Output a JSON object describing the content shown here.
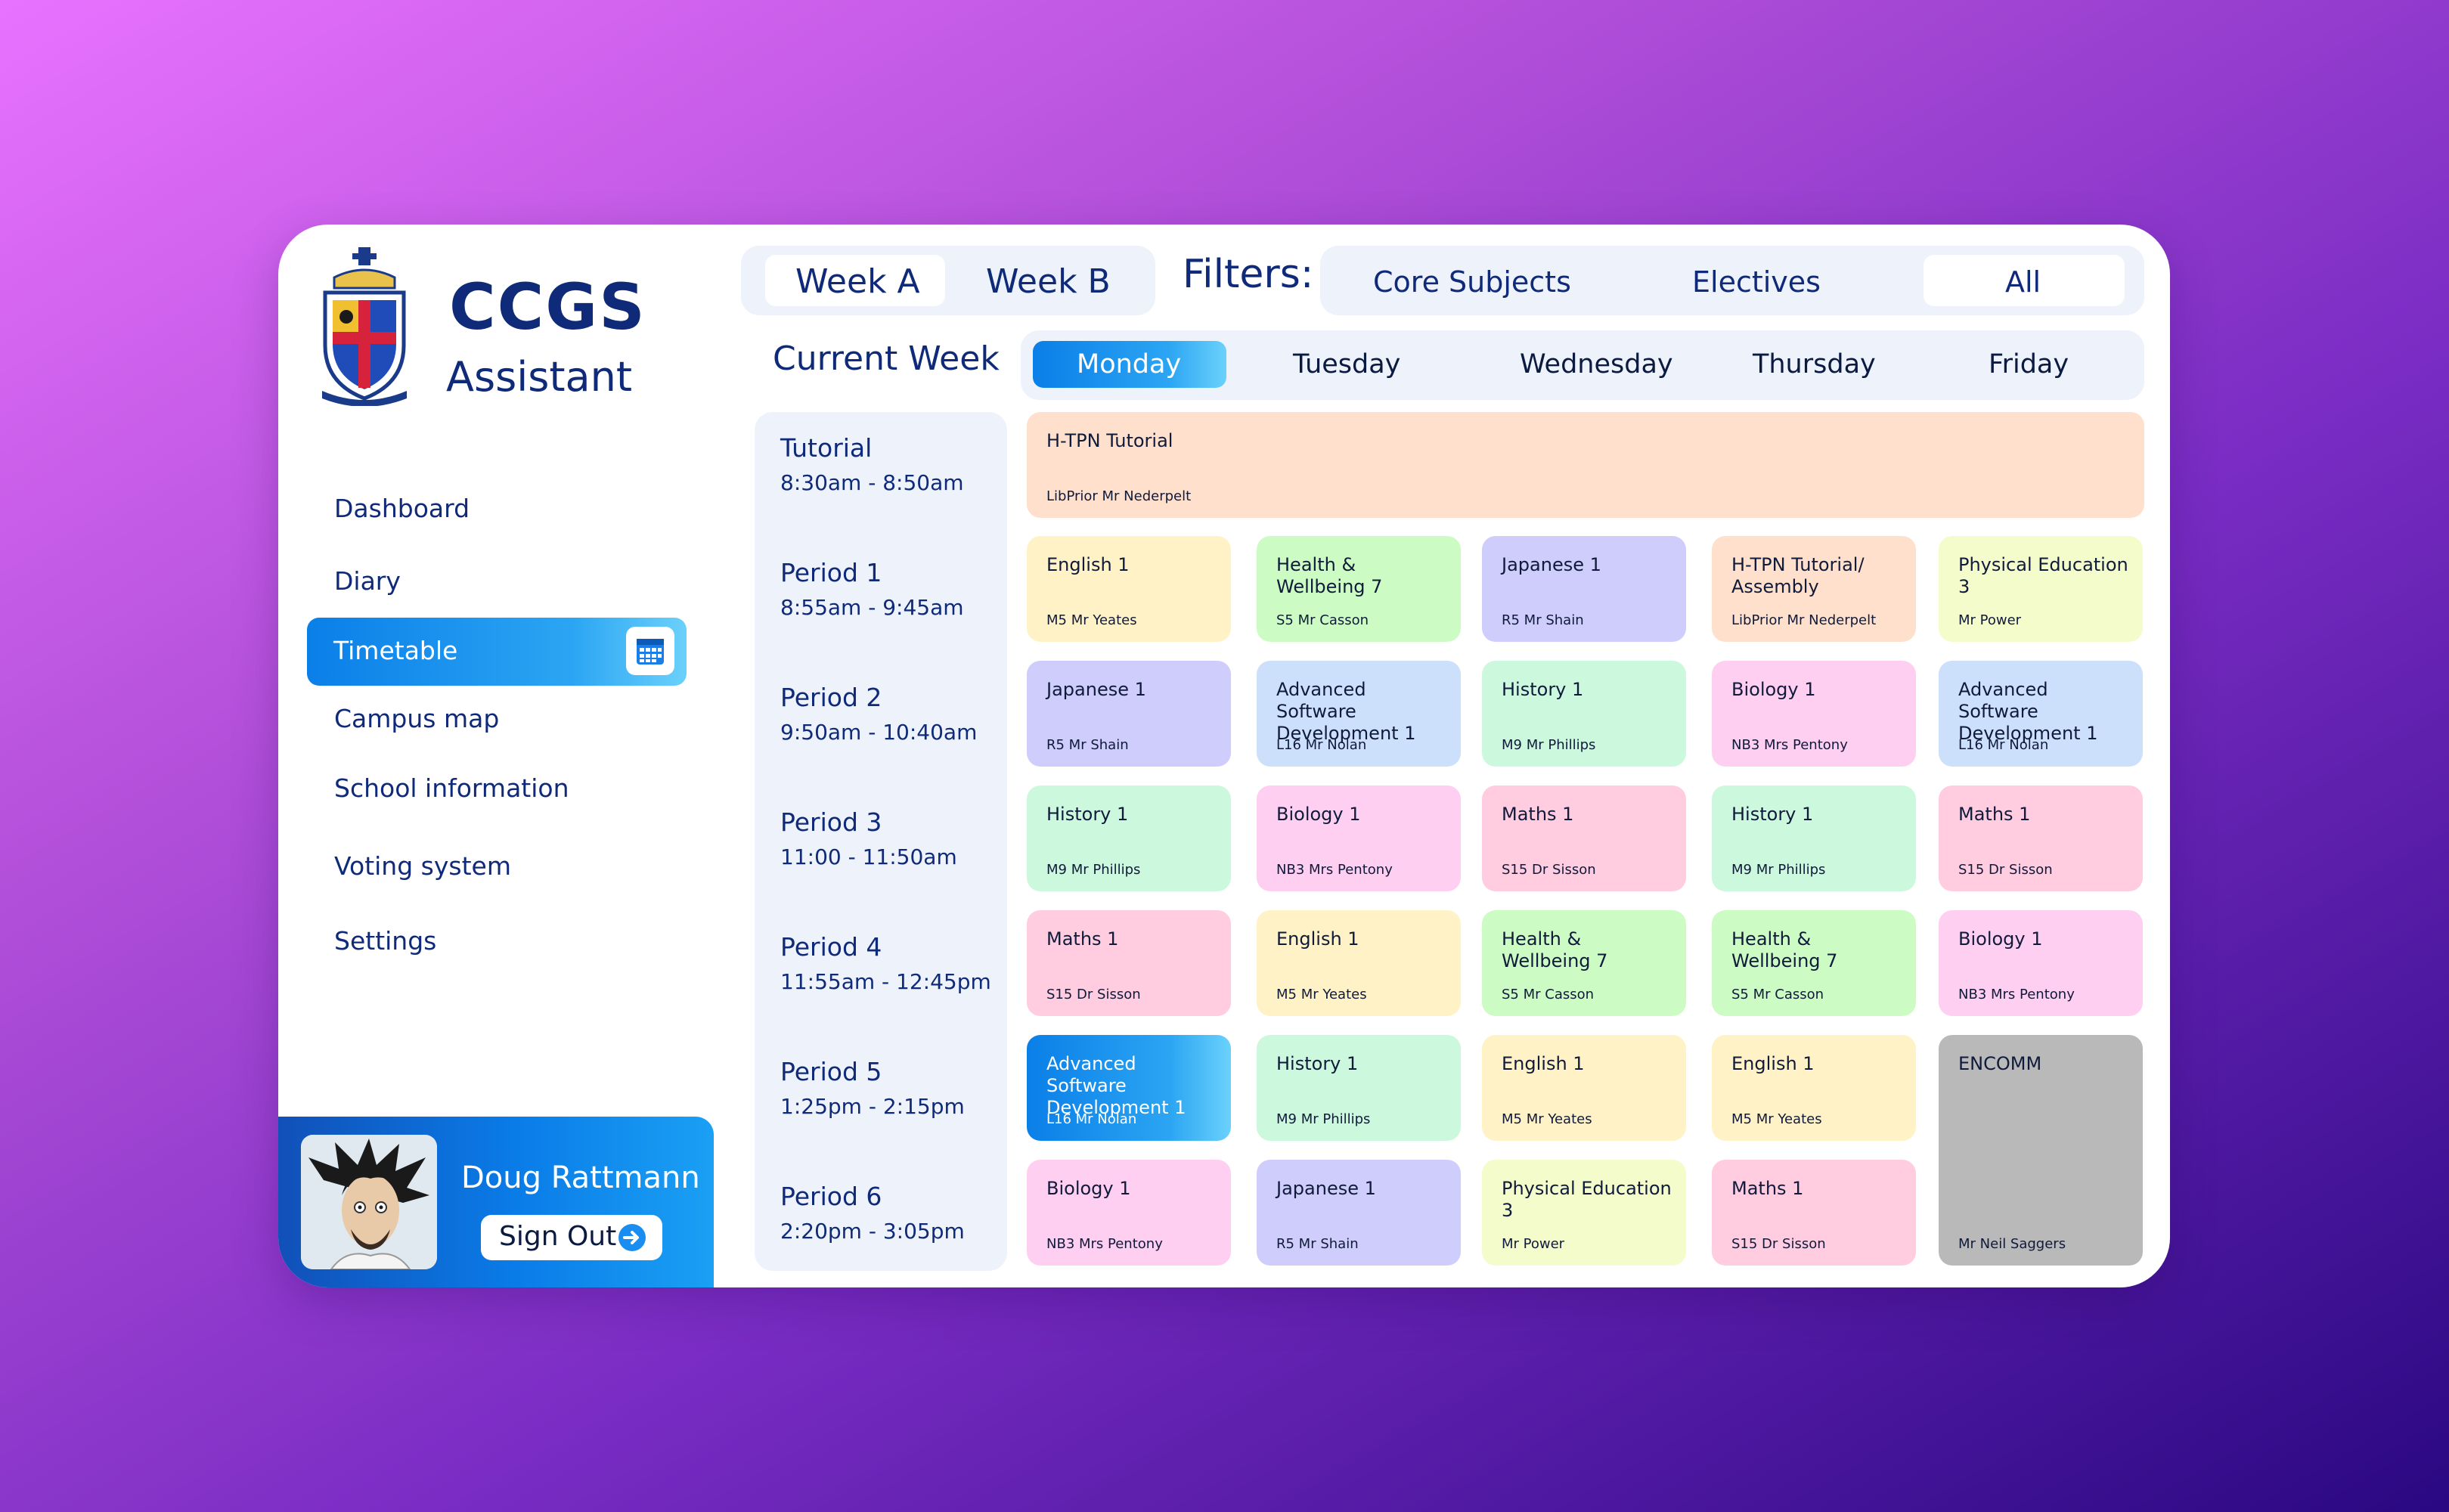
{
  "brand": {
    "title": "CCGS",
    "subtitle": "Assistant"
  },
  "nav": {
    "dashboard": "Dashboard",
    "diary": "Diary",
    "timetable": "Timetable",
    "campus_map": "Campus map",
    "school_info": "School information",
    "voting": "Voting system",
    "settings": "Settings"
  },
  "user": {
    "name": "Doug Rattmann",
    "sign_out": "Sign Out"
  },
  "weeks": {
    "a": "Week A",
    "b": "Week B",
    "selected": "Week A"
  },
  "filters": {
    "label": "Filters:",
    "core": "Core Subjects",
    "electives": "Electives",
    "all": "All",
    "selected": "All"
  },
  "current_week": "Current Week",
  "days": [
    "Monday",
    "Tuesday",
    "Wednesday",
    "Thursday",
    "Friday"
  ],
  "selected_day": "Monday",
  "periods": [
    {
      "name": "Tutorial",
      "time": "8:30am - 8:50am"
    },
    {
      "name": "Period 1",
      "time": "8:55am - 9:45am"
    },
    {
      "name": "Period 2",
      "time": "9:50am - 10:40am"
    },
    {
      "name": "Period 3",
      "time": "11:00 - 11:50am"
    },
    {
      "name": "Period 4",
      "time": "11:55am - 12:45pm"
    },
    {
      "name": "Period 5",
      "time": "1:25pm - 2:15pm"
    },
    {
      "name": "Period 6",
      "time": "2:20pm - 3:05pm"
    }
  ],
  "tutorial": {
    "title": "H-TPN Tutorial",
    "sub": "LibPrior Mr Nederpelt",
    "color": "#ffe0cc"
  },
  "grid": [
    [
      {
        "title": "English 1",
        "sub": "M5 Mr Yeates",
        "color": "#fff2c6"
      },
      {
        "title": "Japanese 1",
        "sub": "R5 Mr Shain",
        "color": "#cfcdfb"
      },
      {
        "title": "History 1",
        "sub": "M9 Mr Phillips",
        "color": "#ccf8dd"
      },
      {
        "title": "Maths 1",
        "sub": "S15 Dr Sisson",
        "color": "#ffcce0"
      },
      {
        "title": "Advanced Software Development 1",
        "sub": "L16 Mr Nolan",
        "color": "#1a8ef0"
      },
      {
        "title": "Biology 1",
        "sub": "NB3 Mrs Pentony",
        "color": "#ffcff2"
      }
    ],
    [
      {
        "title": "Health & Wellbeing 7",
        "sub": "S5 Mr Casson",
        "color": "#ccfcc4"
      },
      {
        "title": "Advanced Software Development 1",
        "sub": "L16 Mr Nolan",
        "color": "#cde0fb"
      },
      {
        "title": "Biology 1",
        "sub": "NB3 Mrs Pentony",
        "color": "#ffcff2"
      },
      {
        "title": "English 1",
        "sub": "M5 Mr Yeates",
        "color": "#fff2c6"
      },
      {
        "title": "History 1",
        "sub": "M9 Mr Phillips",
        "color": "#ccf8dd"
      },
      {
        "title": "Japanese 1",
        "sub": "R5 Mr Shain",
        "color": "#cfcdfb"
      }
    ],
    [
      {
        "title": "Japanese 1",
        "sub": "R5 Mr Shain",
        "color": "#cfcdfb"
      },
      {
        "title": "History 1",
        "sub": "M9 Mr Phillips",
        "color": "#ccf8dd"
      },
      {
        "title": "Maths 1",
        "sub": "S15 Dr Sisson",
        "color": "#ffcce0"
      },
      {
        "title": "Health & Wellbeing 7",
        "sub": "S5 Mr Casson",
        "color": "#ccfcc4"
      },
      {
        "title": "English 1",
        "sub": "M5 Mr Yeates",
        "color": "#fff2c6"
      },
      {
        "title": "Physical Education 3",
        "sub": "Mr Power",
        "color": "#f4fccc"
      }
    ],
    [
      {
        "title": "H-TPN Tutorial/ Assembly",
        "sub": "LibPrior Mr Nederpelt",
        "color": "#ffe0cc"
      },
      {
        "title": "Biology 1",
        "sub": "NB3 Mrs Pentony",
        "color": "#ffcff2"
      },
      {
        "title": "History 1",
        "sub": "M9 Mr Phillips",
        "color": "#ccf8dd"
      },
      {
        "title": "Health & Wellbeing 7",
        "sub": "S5 Mr Casson",
        "color": "#ccfcc4"
      },
      {
        "title": "English 1",
        "sub": "M5 Mr Yeates",
        "color": "#fff2c6"
      },
      {
        "title": "Maths 1",
        "sub": "S15 Dr Sisson",
        "color": "#ffcce0"
      }
    ],
    [
      {
        "title": "Physical Education 3",
        "sub": "Mr Power",
        "color": "#f4fccc"
      },
      {
        "title": "Advanced Software Development 1",
        "sub": "L16 Mr Nolan",
        "color": "#cde0fb"
      },
      {
        "title": "Maths 1",
        "sub": "S15 Dr Sisson",
        "color": "#ffcce0"
      },
      {
        "title": "Biology 1",
        "sub": "NB3 Mrs Pentony",
        "color": "#ffcff2"
      },
      {
        "title": "ENCOMM",
        "sub": "Mr Neil Saggers",
        "color": "#b9b9b9"
      }
    ]
  ]
}
